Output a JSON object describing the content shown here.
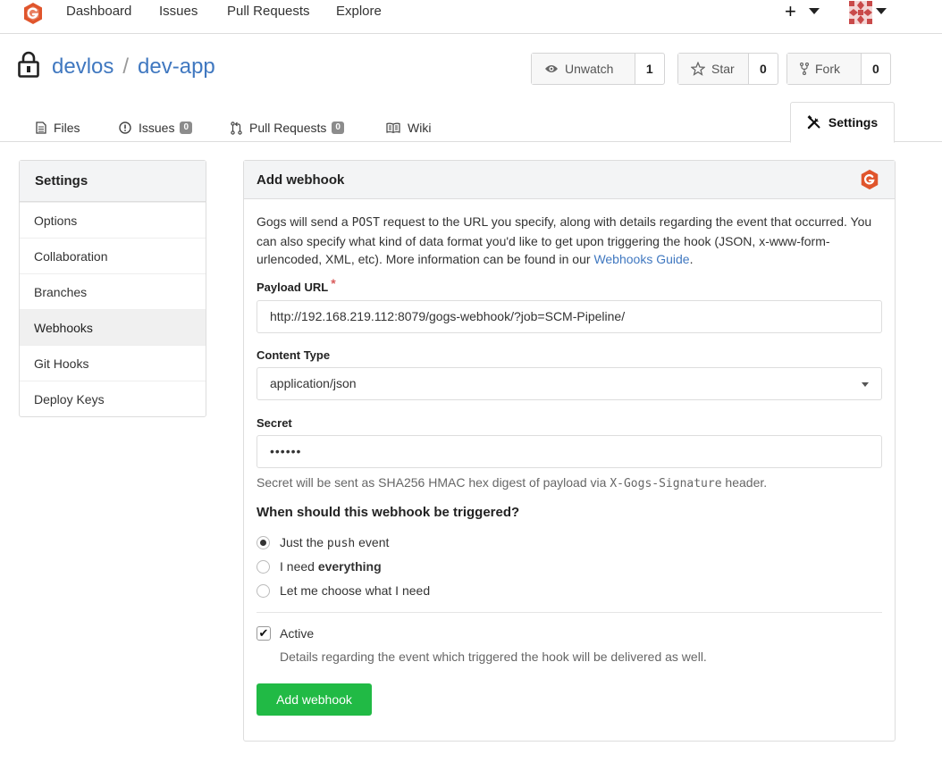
{
  "nav": {
    "items": [
      "Dashboard",
      "Issues",
      "Pull Requests",
      "Explore"
    ],
    "plus": "+"
  },
  "repo": {
    "owner": "devlos",
    "separator": "/",
    "name": "dev-app"
  },
  "actions": {
    "watch": {
      "label": "Unwatch",
      "count": "1"
    },
    "star": {
      "label": "Star",
      "count": "0"
    },
    "fork": {
      "label": "Fork",
      "count": "0"
    }
  },
  "tabs": {
    "files": "Files",
    "issues": {
      "label": "Issues",
      "count": "0"
    },
    "pulls": {
      "label": "Pull Requests",
      "count": "0"
    },
    "wiki": "Wiki",
    "settings": "Settings"
  },
  "sidebar": {
    "title": "Settings",
    "items": [
      "Options",
      "Collaboration",
      "Branches",
      "Webhooks",
      "Git Hooks",
      "Deploy Keys"
    ],
    "active": "Webhooks"
  },
  "panel": {
    "title": "Add webhook",
    "desc_part1": "Gogs will send a ",
    "desc_code": "POST",
    "desc_part2": " request to the URL you specify, along with details regarding the event that occurred. You can also specify what kind of data format you'd like to get upon triggering the hook (JSON, x-www-form-urlencoded, XML, etc). More information can be found in our ",
    "desc_link": "Webhooks Guide",
    "desc_end": ".",
    "payload_label": "Payload URL",
    "required_mark": "*",
    "payload_value": "http://192.168.219.112:8079/gogs-webhook/?job=SCM-Pipeline/",
    "content_type_label": "Content Type",
    "content_type_value": "application/json",
    "secret_label": "Secret",
    "secret_value": "••••••",
    "secret_help_1": "Secret will be sent as SHA256 HMAC hex digest of payload via ",
    "secret_help_code": "X-Gogs-Signature",
    "secret_help_2": " header.",
    "trigger_title": "When should this webhook be triggered?",
    "trigger_push_1": "Just the ",
    "trigger_push_code": "push",
    "trigger_push_2": " event",
    "trigger_all_1": "I need ",
    "trigger_all_bold": "everything",
    "trigger_choose": "Let me choose what I need",
    "active_label": "Active",
    "active_help": "Details regarding the event which triggered the hook will be delivered as well.",
    "submit": "Add webhook"
  },
  "colors": {
    "link": "#4078c0",
    "brand": "#e0552c",
    "success": "#21ba45",
    "required": "#d95c5c"
  },
  "icons": [
    "gogs-logo-icon",
    "plus-icon",
    "avatar",
    "lock-icon",
    "eye-icon",
    "star-icon",
    "fork-icon",
    "file-icon",
    "issue-icon",
    "pull-request-icon",
    "book-icon",
    "tools-icon"
  ]
}
